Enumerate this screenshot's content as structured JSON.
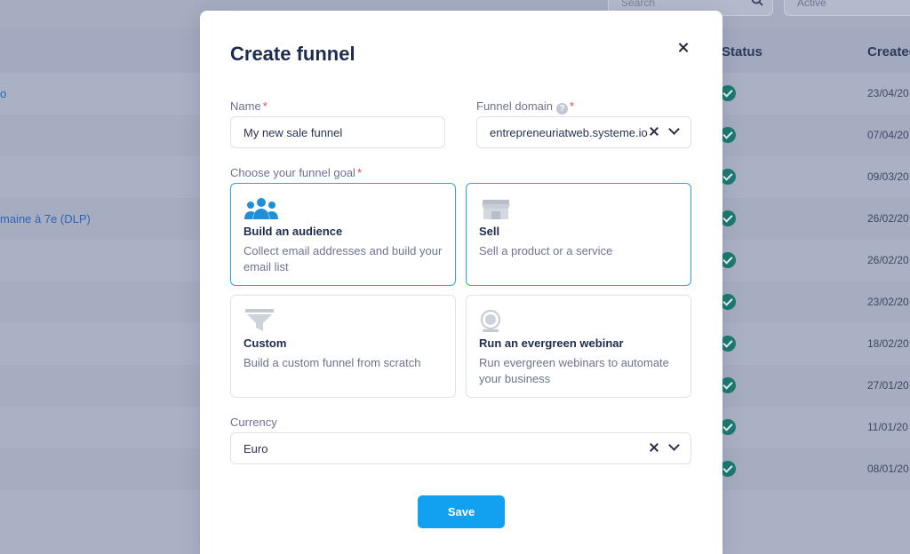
{
  "background": {
    "search_placeholder": "Search",
    "filter_value": "Active",
    "columns": {
      "status": "Status",
      "created": "Created"
    },
    "rows": [
      {
        "name": "o",
        "date": "23/04/20"
      },
      {
        "name": "",
        "date": "07/04/20"
      },
      {
        "name": "",
        "date": "09/03/20"
      },
      {
        "name": "maine à 7e (DLP)",
        "date": "26/02/20"
      },
      {
        "name": "",
        "date": "26/02/20"
      },
      {
        "name": "",
        "date": "23/02/20"
      },
      {
        "name": "",
        "date": "18/02/20"
      },
      {
        "name": "",
        "date": "27/01/20"
      },
      {
        "name": "",
        "date": "11/01/20"
      },
      {
        "name": "",
        "date": "08/01/20"
      }
    ]
  },
  "modal": {
    "title": "Create funnel",
    "name_field": {
      "label": "Name",
      "value": "My new sale funnel"
    },
    "domain_field": {
      "label": "Funnel domain",
      "help": "?",
      "value": "entrepreneuriatweb.systeme.io"
    },
    "goal_label": "Choose your funnel goal",
    "goals": [
      {
        "title": "Build an audience",
        "description": "Collect email addresses and build your email list",
        "icon": "people-icon",
        "selected": true
      },
      {
        "title": "Sell",
        "description": "Sell a product or a service",
        "icon": "store-icon",
        "selected": true
      },
      {
        "title": "Custom",
        "description": "Build a custom funnel from scratch",
        "icon": "funnel-icon",
        "selected": false
      },
      {
        "title": "Run an evergreen webinar",
        "description": "Run evergreen webinars to automate your business",
        "icon": "webinar-icon",
        "selected": false
      }
    ],
    "currency_field": {
      "label": "Currency",
      "value": "Euro"
    },
    "save_label": "Save",
    "required_mark": "*"
  },
  "colors": {
    "accent": "#12a0f0",
    "selected_border": "#2aa6d8",
    "title": "#1d2b4f",
    "required": "#e2455a",
    "status_check": "#1c7a72"
  }
}
